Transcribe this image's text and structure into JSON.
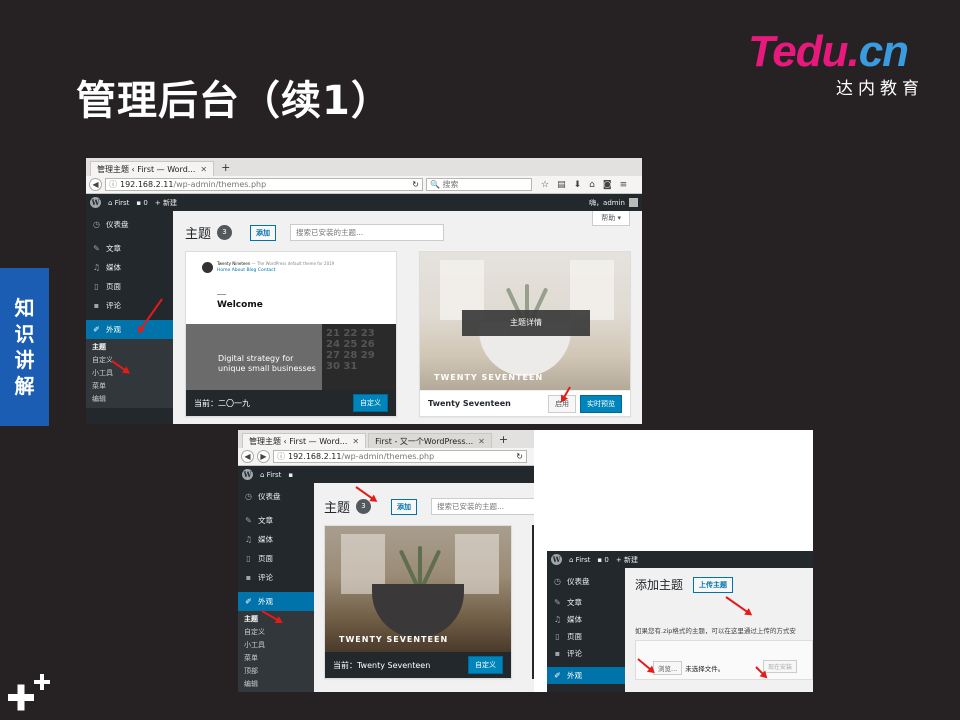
{
  "slide": {
    "title": "管理后台（续1）",
    "logo_main": "Tedu.",
    "logo_cn": "cn",
    "logo_sub": "达内教育",
    "side_tab": "知识讲解"
  },
  "shot1": {
    "tab1": "管理主题 ‹ First — Word...",
    "url_host": "192.168.2.11",
    "url_path": "/wp-admin/themes.php",
    "search_placeholder": "搜索",
    "site_name": "First",
    "comments": "0",
    "new": "新建",
    "greeting": "嗨，admin",
    "menu": [
      "仪表盘",
      "文章",
      "媒体",
      "页面",
      "评论",
      "外观"
    ],
    "submenu": [
      "主题",
      "自定义",
      "小工具",
      "菜单",
      "编辑"
    ],
    "help": "帮助 ▾",
    "page_title": "主题",
    "count": "3",
    "add": "添加",
    "theme_search": "搜索已安装的主题...",
    "theme1_site": "Twenty Nineteen",
    "theme1_tagline": "— The WordPress default theme for 2019",
    "theme1_nav": "Home  About  Blog  Contact",
    "theme1_welcome": "Welcome",
    "theme1_hero": "Digital strategy for unique small businesses",
    "theme1_current": "当前：二〇一九",
    "customize": "自定义",
    "theme2_details": "主题详情",
    "theme2_ss": "TWENTY SEVENTEEN",
    "theme2_name": "Twenty Seventeen",
    "activate": "启用",
    "live_preview": "实时预览"
  },
  "shot2": {
    "tab1": "管理主题 ‹ First — Word...",
    "tab2": "First - 又一个WordPress...",
    "url_host": "192.168.2.11",
    "url_path": "/wp-admin/themes.php",
    "site_name": "First",
    "menu": [
      "仪表盘",
      "文章",
      "媒体",
      "页面",
      "评论",
      "外观"
    ],
    "submenu": [
      "主题",
      "自定义",
      "小工具",
      "菜单",
      "顶部",
      "编辑"
    ],
    "page_title": "主题",
    "count": "3",
    "add": "添加",
    "theme_search": "搜索已安装的主题...",
    "theme_ss": "TWENTY SEVENTEEN",
    "theme_current": "当前：Twenty Seventeen",
    "customize": "自定义"
  },
  "shot3": {
    "site_name": "First",
    "comments": "0",
    "new": "新建",
    "menu": [
      "仪表盘",
      "文章",
      "媒体",
      "页面",
      "评论",
      "外观"
    ],
    "page_title": "添加主题",
    "upload": "上传主题",
    "hint": "如果您有.zip格式的主题，可以在这里通过上传的方式安",
    "browse": "浏览...",
    "no_file": "未选择文件。",
    "install": "现在安装"
  },
  "colors": {
    "wp_dark": "#23282d",
    "wp_blue": "#0073aa",
    "accent_red": "#e31b1b",
    "side_tab": "#1a5db3"
  }
}
